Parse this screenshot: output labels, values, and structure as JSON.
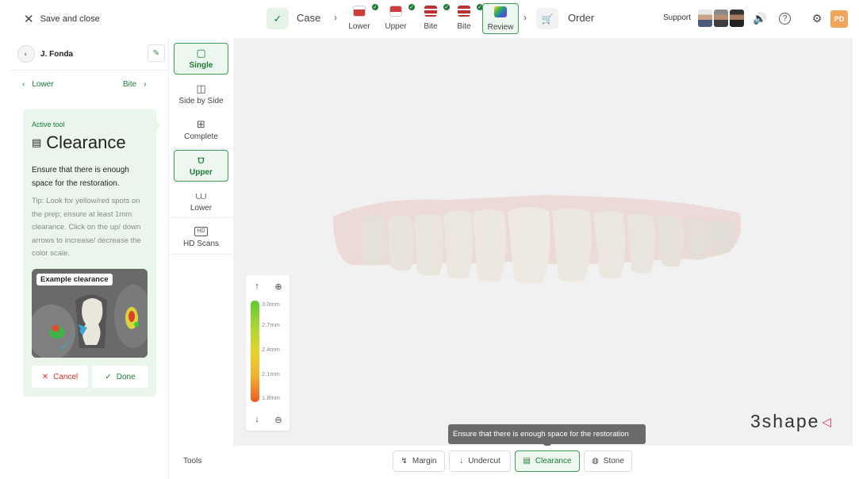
{
  "topbar": {
    "save_close": "Save and close",
    "case": "Case",
    "steps": [
      {
        "label": "Lower",
        "done": true
      },
      {
        "label": "Upper",
        "done": true
      },
      {
        "label": "Bite",
        "done": true
      },
      {
        "label": "Bite",
        "done": true
      },
      {
        "label": "Review",
        "active": true
      }
    ],
    "order": "Order",
    "support": "Support",
    "user_initials": "PD"
  },
  "patient": {
    "name": "J. Fonda"
  },
  "nav": {
    "prev": "Lower",
    "next": "Bite"
  },
  "active_tool": {
    "label": "Active tool",
    "title": "Clearance",
    "description": "Ensure that there is enough space for the restoration.",
    "tip": "Tip: Look for yellow/red spots on the prep; ensure at least 1mm clearance. Click on the up/ down arrows to increase/ decrease the color scale.",
    "example_label": "Example clearance",
    "cancel": "Cancel",
    "done": "Done"
  },
  "views": {
    "layout": [
      {
        "label": "Single",
        "selected": true
      },
      {
        "label": "Side by Side"
      },
      {
        "label": "Complete"
      }
    ],
    "jaw": [
      {
        "label": "Upper",
        "selected": true
      },
      {
        "label": "Lower"
      }
    ],
    "hd": {
      "label": "HD Scans",
      "icon_text": "HD"
    }
  },
  "color_scale": {
    "ticks": [
      "3.0mm",
      "2.7mm",
      "2.4mm",
      "2.1mm",
      "1.8mm"
    ]
  },
  "tooltip": "Ensure that there is enough space for the restoration",
  "bottom": {
    "tools_label": "Tools",
    "tools": [
      {
        "label": "Margin"
      },
      {
        "label": "Undercut"
      },
      {
        "label": "Clearance",
        "selected": true
      },
      {
        "label": "Stone"
      }
    ]
  },
  "logo": "3shape",
  "colors": {
    "accent": "#1d7a34",
    "cancel": "#d4322c",
    "avatar_bg": "#f0a55a"
  }
}
